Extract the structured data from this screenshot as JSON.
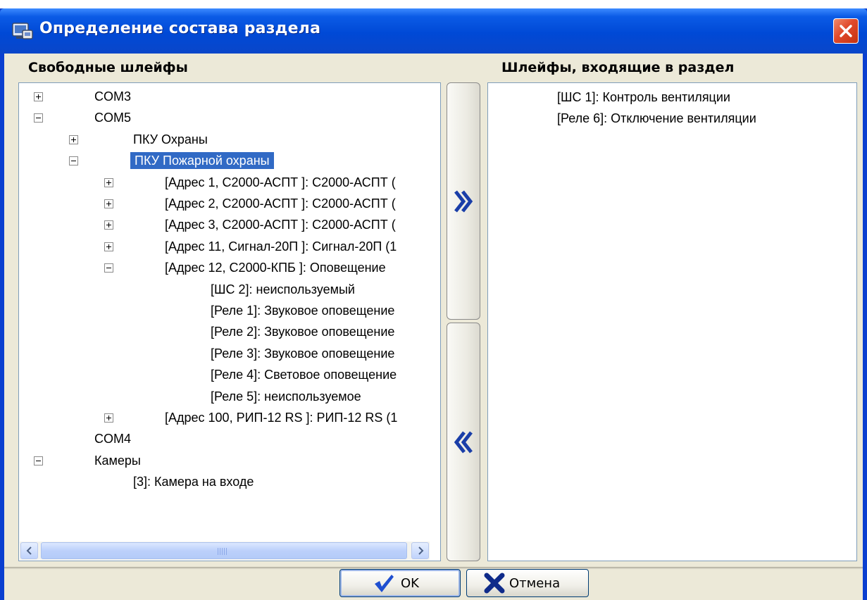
{
  "window": {
    "title": "Определение состава раздела"
  },
  "free_loops": {
    "label": "Свободные шлейфы",
    "rows": [
      {
        "text": "COM3",
        "expander": "plus",
        "level": 0
      },
      {
        "text": "COM5",
        "expander": "minus",
        "level": 0
      },
      {
        "text": "ПКУ Охраны",
        "expander": "plus",
        "level": 1
      },
      {
        "text": "ПКУ Пожарной охраны",
        "expander": "minus",
        "level": 1,
        "selected": true
      },
      {
        "text": "[Адрес 1, С2000-АСПТ ]: С2000-АСПТ (",
        "expander": "plus",
        "level": 2
      },
      {
        "text": "[Адрес 2, С2000-АСПТ ]: С2000-АСПТ (",
        "expander": "plus",
        "level": 2
      },
      {
        "text": "[Адрес 3, С2000-АСПТ ]: С2000-АСПТ (",
        "expander": "plus",
        "level": 2
      },
      {
        "text": "[Адрес 11, Сигнал-20П ]: Сигнал-20П (1",
        "expander": "plus",
        "level": 2
      },
      {
        "text": "[Адрес 12, С2000-КПБ ]: Оповещение",
        "expander": "minus",
        "level": 2
      },
      {
        "text": "[ШС 2]: неиспользуемый",
        "expander": "none",
        "level": 3
      },
      {
        "text": "[Реле 1]: Звуковое оповещение",
        "expander": "none",
        "level": 3
      },
      {
        "text": "[Реле 2]: Звуковое оповещение",
        "expander": "none",
        "level": 3
      },
      {
        "text": "[Реле 3]: Звуковое оповещение",
        "expander": "none",
        "level": 3
      },
      {
        "text": "[Реле 4]: Световое оповещение",
        "expander": "none",
        "level": 3
      },
      {
        "text": "[Реле 5]: неиспользуемое",
        "expander": "none",
        "level": 3
      },
      {
        "text": "[Адрес 100, РИП-12 RS ]: РИП-12 RS (1",
        "expander": "plus",
        "level": 2
      },
      {
        "text": "COM4",
        "expander": "none",
        "level": 0
      },
      {
        "text": "Камеры",
        "expander": "minus",
        "level": 0
      },
      {
        "text": "[3]: Камера на входе",
        "expander": "none",
        "level": 1
      }
    ]
  },
  "section_loops": {
    "label": "Шлейфы, входящие в раздел",
    "items": [
      "[ШС 1]: Контроль вентиляции",
      "[Реле 6]: Отключение вентиляции"
    ]
  },
  "buttons": {
    "ok": "OK",
    "cancel": "Отмена"
  },
  "colors": {
    "title_bar": "#0a46c9",
    "selection": "#316ac5",
    "arrow": "#1a3ea8",
    "ok_check": "#1f4fd0",
    "cancel_x": "#0f2b8a"
  },
  "icons": {
    "title": "app-window-icon",
    "close": "close-icon",
    "add": "double-chevron-right-icon",
    "remove": "double-chevron-left-icon",
    "ok": "checkmark-icon",
    "cancel": "x-mark-icon"
  }
}
